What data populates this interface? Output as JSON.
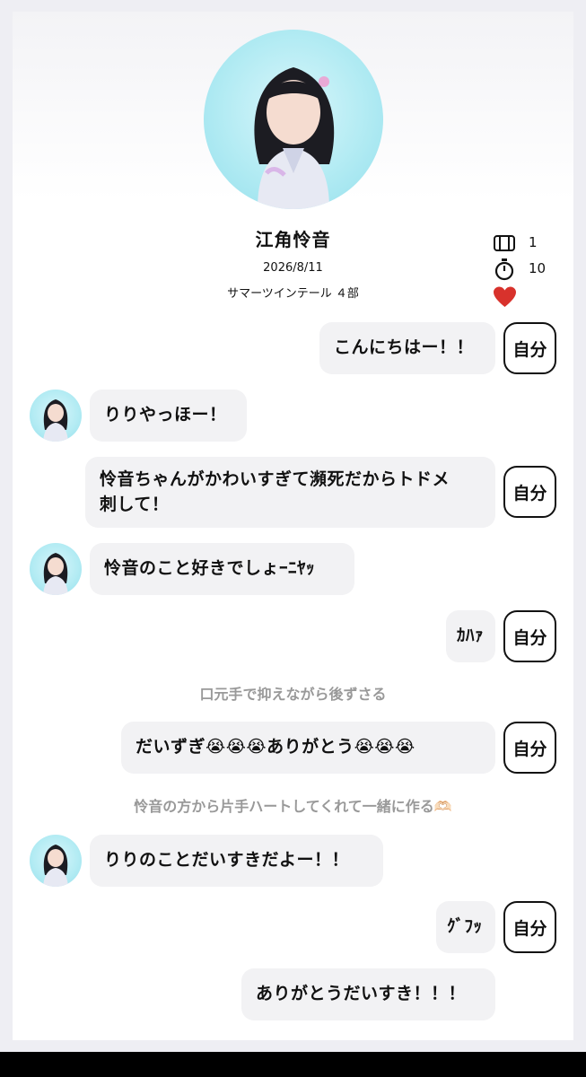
{
  "profile": {
    "name": "江角怜音",
    "date": "2026/8/11",
    "event": "サマーツインテール ４部",
    "tickets": "1",
    "seconds": "10"
  },
  "self_label": "自分",
  "messages": {
    "m1": "こんにちはー！！",
    "m2": "りりやっほー！",
    "m3_line1": "怜音ちゃんがかわいすぎて瀕死だからトドメ",
    "m3_line2": "刺して！",
    "m4": "怜音のこと好きでしょｰﾆﾔｯ",
    "m5": "ｶﾊｧ",
    "m6": "だいずぎ😭😭😭ありがとう😭😭😭",
    "m7": "りりのことだいすきだよー！！",
    "m8": "ｸﾞﾌｯ",
    "m9": "ありがとうだいすき！！！"
  },
  "narrations": {
    "n1": "口元手で抑えながら後ずさる",
    "n2": "怜音の方から片手ハートしてくれて一緒に作る🫶🏻"
  },
  "colors": {
    "bubble": "#f2f2f4",
    "avatar_bg": "#b2ebf3",
    "heart": "#d8322c",
    "narration": "#999999"
  }
}
